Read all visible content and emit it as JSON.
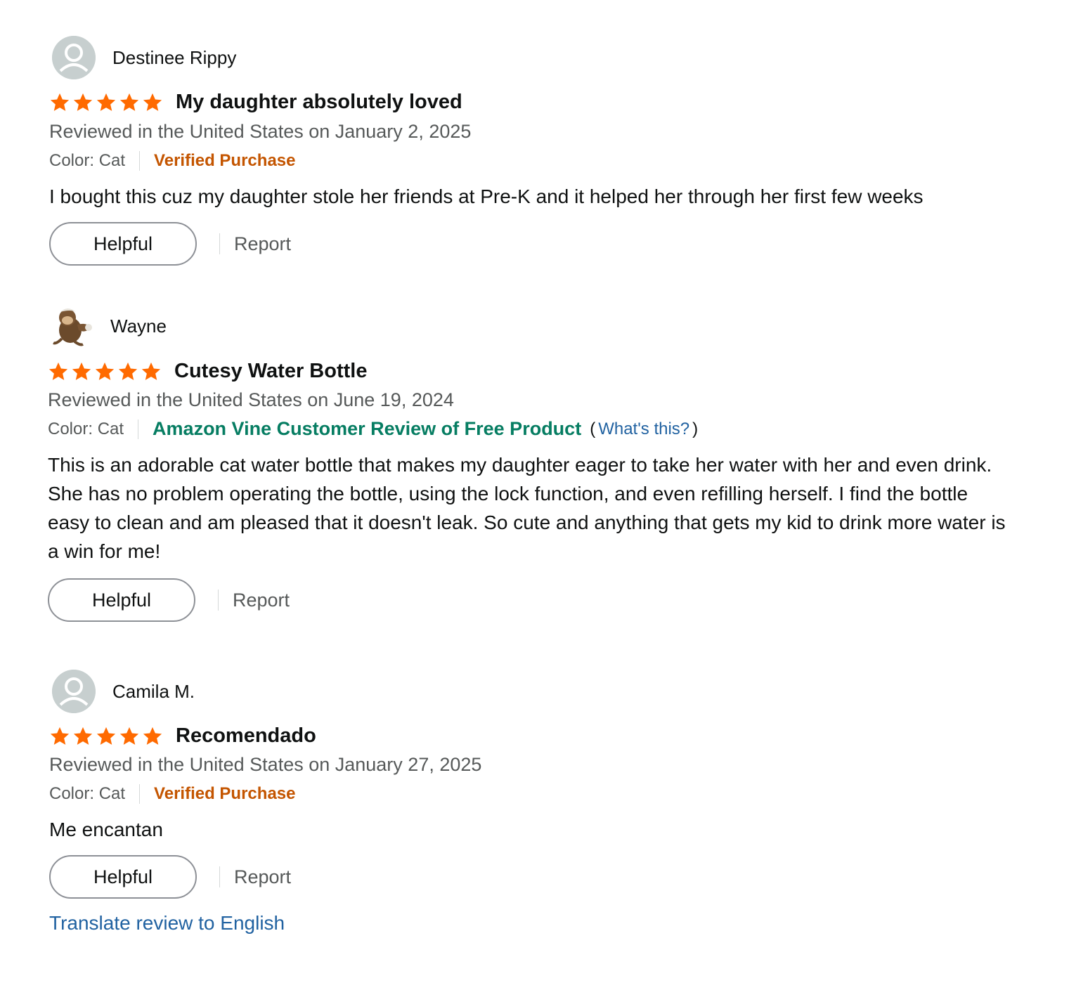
{
  "reviews": [
    {
      "name": "Destinee Rippy",
      "avatar": "default-person-icon",
      "rating": 5,
      "title": "My daughter absolutely loved",
      "date": "Reviewed in the United States on January 2, 2025",
      "color": "Color: Cat",
      "badge": "Verified Purchase",
      "body": "I bought this cuz my daughter stole her friends at Pre-K and it helped her through her first few weeks",
      "helpful": "Helpful",
      "report": "Report"
    },
    {
      "name": "Wayne",
      "avatar": "monkey-avatar",
      "rating": 5,
      "title": "Cutesy Water Bottle",
      "date": "Reviewed in the United States on June 19, 2024",
      "color": "Color: Cat",
      "badge": "Amazon Vine Customer Review of Free Product",
      "badge_paren_open": "(",
      "whats_this": "What's this?",
      "badge_paren_close": ")",
      "body": "This is an adorable cat water bottle that makes my daughter eager to take her water with her and even drink. She has no problem operating the bottle, using the lock function, and even refilling herself. I find the bottle easy to clean and am pleased that it doesn't leak. So cute and anything that gets my kid to drink more water is a win for me!",
      "helpful": "Helpful",
      "report": "Report"
    },
    {
      "name": "Camila M.",
      "avatar": "default-person-icon",
      "rating": 5,
      "title": "Recomendado",
      "date": "Reviewed in the United States on January 27, 2025",
      "color": "Color: Cat",
      "badge": "Verified Purchase",
      "body": "Me encantan",
      "helpful": "Helpful",
      "report": "Report",
      "translate": "Translate review to English"
    }
  ],
  "colors": {
    "star": "#ff6a00",
    "verified": "#c45500",
    "vine": "#067d62",
    "link": "#2162a1",
    "muted": "#565959"
  }
}
